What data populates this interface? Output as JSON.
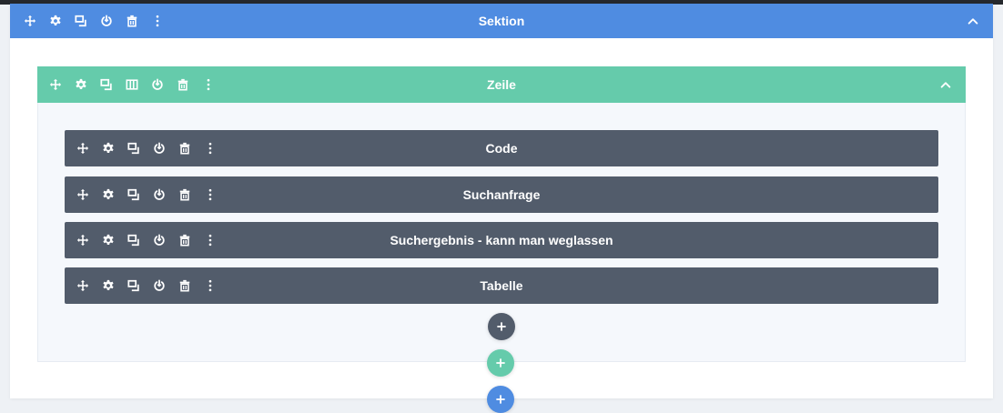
{
  "colors": {
    "section": "#4f8ce1",
    "row": "#65cbab",
    "module": "#525c6b",
    "page_bg": "#eef1f5"
  },
  "section": {
    "title": "Sektion",
    "icons": [
      "move-icon",
      "gear-icon",
      "duplicate-icon",
      "power-icon",
      "trash-icon",
      "more-icon"
    ],
    "collapse_icon": "chevron-up-icon"
  },
  "row": {
    "title": "Zeile",
    "icons": [
      "move-icon",
      "gear-icon",
      "duplicate-icon",
      "columns-icon",
      "power-icon",
      "trash-icon",
      "more-icon"
    ],
    "collapse_icon": "chevron-up-icon"
  },
  "modules": [
    {
      "title": "Code"
    },
    {
      "title": "Suchanfrage"
    },
    {
      "title": "Suchergebnis - kann man weglassen"
    },
    {
      "title": "Tabelle"
    }
  ],
  "module_icons": [
    "move-icon",
    "gear-icon",
    "duplicate-icon",
    "power-icon",
    "trash-icon",
    "more-icon"
  ],
  "add_buttons": [
    {
      "name": "add-module-button",
      "icon": "plus-icon",
      "color": "#525c6b"
    },
    {
      "name": "add-row-button",
      "icon": "plus-icon",
      "color": "#65cbab"
    },
    {
      "name": "add-section-button",
      "icon": "plus-icon",
      "color": "#4f8ce1"
    }
  ]
}
